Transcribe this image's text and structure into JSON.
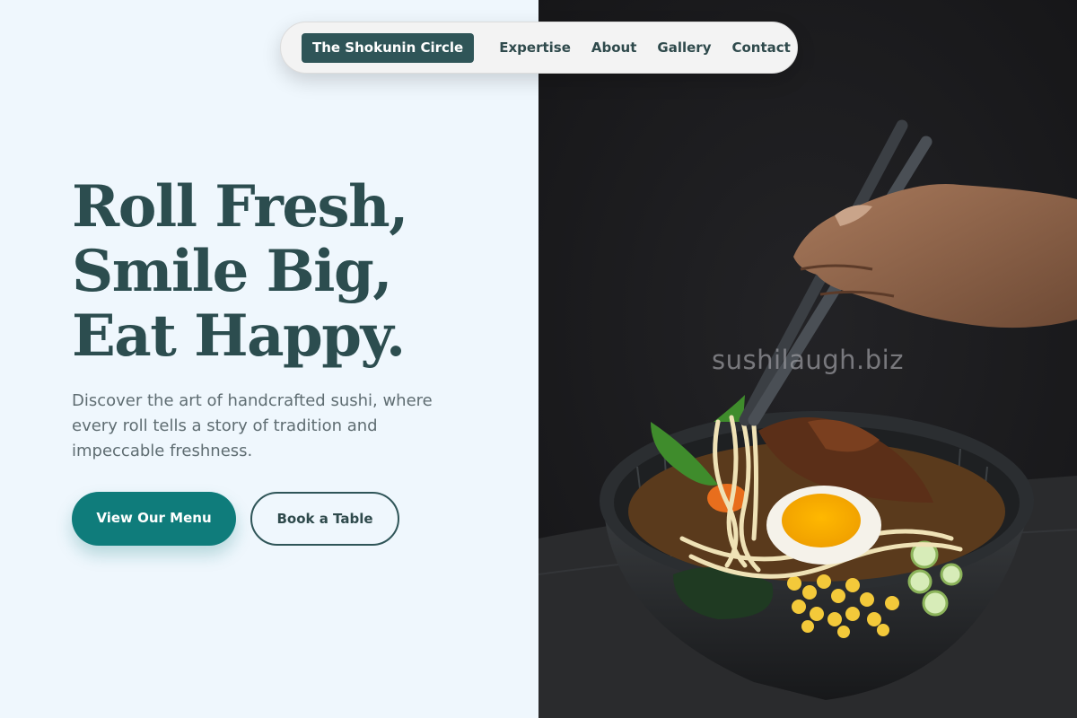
{
  "nav": {
    "brand": "The Shokunin Circle",
    "links": [
      "Expertise",
      "About",
      "Gallery",
      "Contact"
    ]
  },
  "hero": {
    "headline": [
      "Roll Fresh,",
      "Smile Big,",
      "Eat Happy."
    ],
    "subtext": "Discover the art of handcrafted sushi, where every roll tells a story of tradition and impeccable freshness.",
    "primary_button": "View Our Menu",
    "secondary_button": "Book a Table"
  },
  "image": {
    "watermark": "sushilaugh.biz",
    "subject": "hand-with-chopsticks-lifting-ramen-noodles"
  },
  "colors": {
    "background": "#eff7fd",
    "brand": "#2f5558",
    "accent": "#0f7c7b",
    "headline": "#2c4d4f",
    "body_text": "#5f6d72"
  }
}
